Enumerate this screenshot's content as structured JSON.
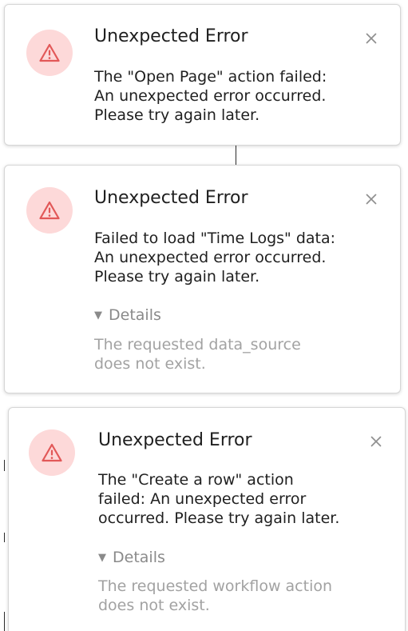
{
  "colors": {
    "icon_background": "#fdd9d9",
    "icon_color": "#e25858",
    "title_text": "#1f1f1f",
    "details_toggle_text": "#8a8a8a",
    "details_text": "#a2a2a2",
    "close_icon": "#8f8f8f"
  },
  "toasts": [
    {
      "icon": "warning-triangle-icon",
      "title": "Unexpected Error",
      "message_lines": [
        "The \"Open Page\" action failed:",
        "An unexpected error occurred.",
        "Please try again later."
      ],
      "close_icon": "close-icon"
    },
    {
      "icon": "warning-triangle-icon",
      "title": "Unexpected Error",
      "message_lines": [
        "Failed to load \"Time Logs\" data:",
        "An unexpected error occurred.",
        "Please try again later."
      ],
      "details_label": "Details",
      "details_caret": "▼",
      "details_lines": [
        "The requested data_source",
        "does not exist."
      ],
      "close_icon": "close-icon"
    },
    {
      "icon": "warning-triangle-icon",
      "title": "Unexpected Error",
      "message_lines": [
        "The \"Create a row\" action",
        "failed: An unexpected error",
        "occurred. Please try again later."
      ],
      "details_label": "Details",
      "details_caret": "▼",
      "details_lines": [
        "The requested workflow action",
        "does not exist."
      ],
      "close_icon": "close-icon"
    }
  ]
}
